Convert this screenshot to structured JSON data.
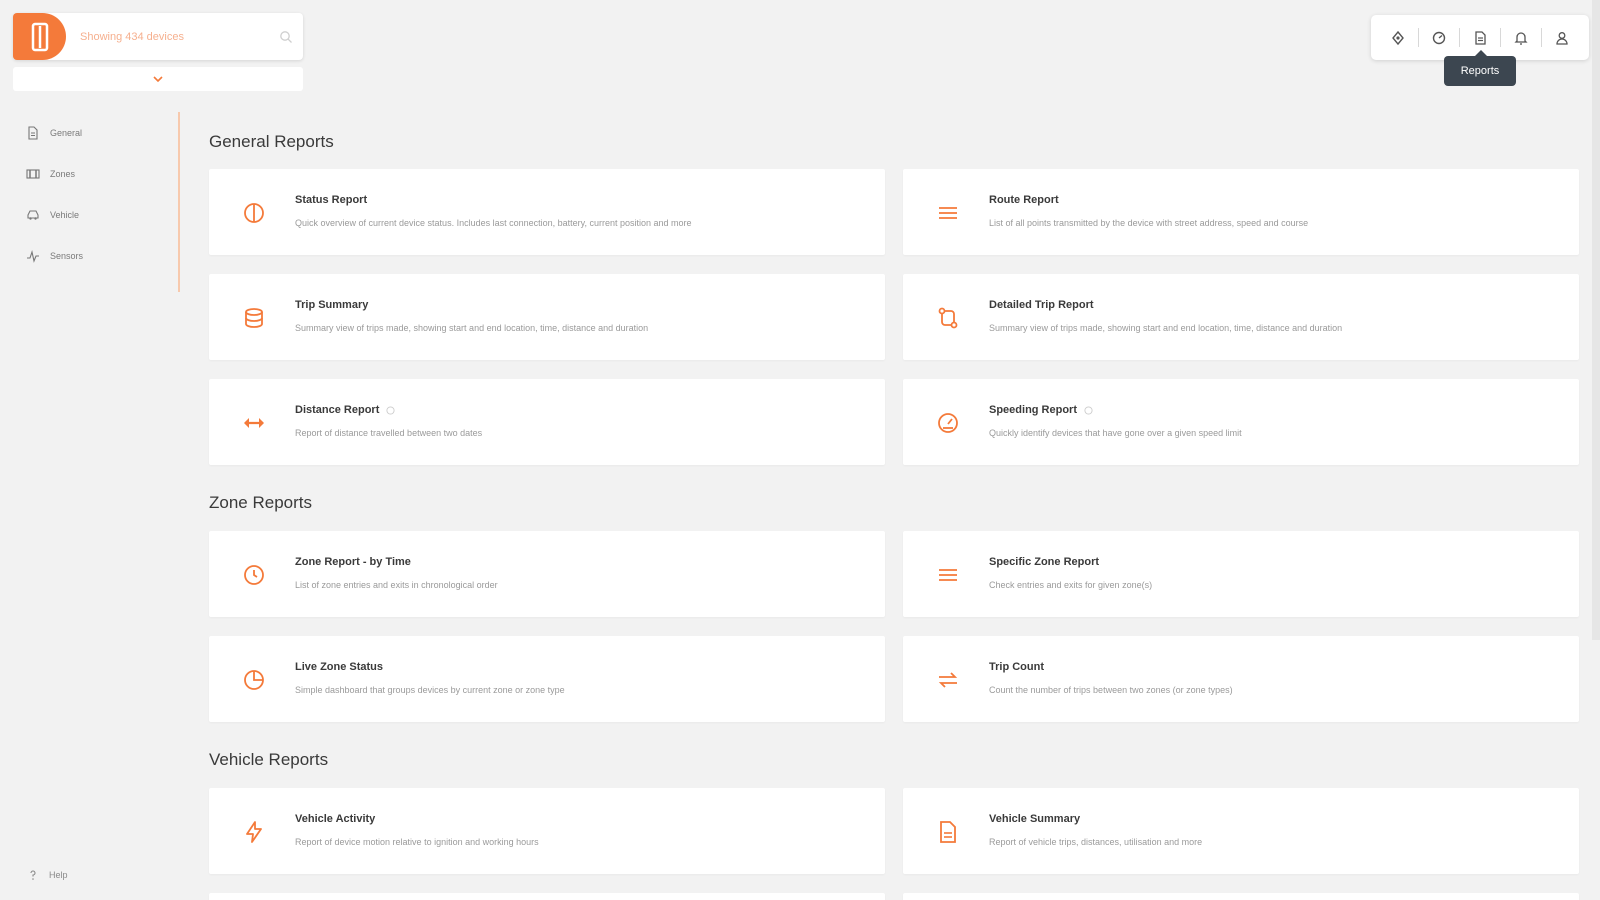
{
  "device_selector": {
    "label": "Showing 434 devices"
  },
  "toolbar": {
    "tooltip": "Reports",
    "buttons": [
      {
        "icon": "live-map-icon"
      },
      {
        "icon": "dashboard-icon"
      },
      {
        "icon": "reports-icon"
      },
      {
        "icon": "notifications-icon"
      },
      {
        "icon": "user-icon"
      }
    ]
  },
  "sidebar": {
    "items": [
      {
        "label": "General",
        "icon": "document-icon"
      },
      {
        "label": "Zones",
        "icon": "zones-icon"
      },
      {
        "label": "Vehicle",
        "icon": "car-icon"
      },
      {
        "label": "Sensors",
        "icon": "sensor-icon"
      }
    ],
    "help_label": "Help",
    "divider_color": "#f7c9ad"
  },
  "sections": [
    {
      "title": "General Reports",
      "cards": [
        {
          "title": "Status Report",
          "description": "Quick overview of current device status. Includes last connection, battery, current position and more",
          "icon": "status-icon"
        },
        {
          "title": "Route Report",
          "description": "List of all points transmitted by the device with street address, speed and course",
          "icon": "list-icon"
        },
        {
          "title": "Trip Summary",
          "description": "Summary view of trips made, showing start and end location, time, distance and duration",
          "icon": "trip-summary-icon"
        },
        {
          "title": "Detailed Trip Report",
          "description": "Summary view of trips made, showing start and end location, time, distance and duration",
          "icon": "route-icon"
        },
        {
          "title": "Distance Report",
          "description": "Report of distance travelled between two dates",
          "icon": "distance-icon",
          "info": true
        },
        {
          "title": "Speeding Report",
          "description": "Quickly identify devices that have gone over a given speed limit",
          "icon": "speedometer-icon",
          "info": true
        }
      ]
    },
    {
      "title": "Zone Reports",
      "cards": [
        {
          "title": "Zone Report - by Time",
          "description": "List of zone entries and exits in chronological order",
          "icon": "clock-icon"
        },
        {
          "title": "Specific Zone Report",
          "description": "Check entries and exits for given zone(s)",
          "icon": "list-icon"
        },
        {
          "title": "Live Zone Status",
          "description": "Simple dashboard that groups devices by current zone or zone type",
          "icon": "pie-icon"
        },
        {
          "title": "Trip Count",
          "description": "Count the number of trips between two zones (or zone types)",
          "icon": "swap-icon"
        }
      ]
    },
    {
      "title": "Vehicle Reports",
      "cards": [
        {
          "title": "Vehicle Activity",
          "description": "Report of device motion relative to ignition and working hours",
          "icon": "bolt-icon"
        },
        {
          "title": "Vehicle Summary",
          "description": "Report of vehicle trips, distances, utilisation and more",
          "icon": "file-icon"
        }
      ]
    }
  ],
  "colors": {
    "accent": "#f47a3a",
    "background": "#f2f2f2",
    "card": "#ffffff",
    "tooltip": "#3c4650"
  }
}
